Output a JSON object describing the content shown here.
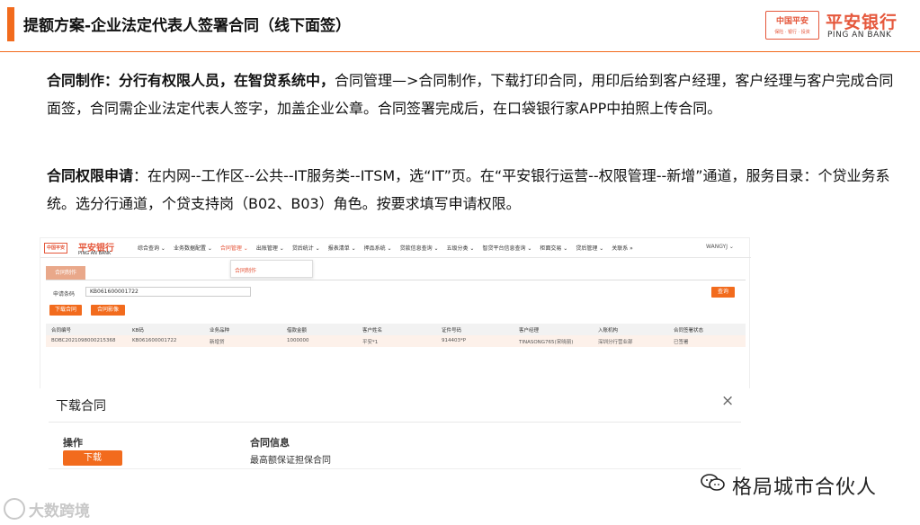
{
  "slide": {
    "title": "提额方案-企业法定代表人签署合同（线下面签）",
    "brand_box_cn": "中国平安",
    "brand_box_sub": "保险 · 银行 · 投资",
    "bank_name_cn": "平安银行",
    "bank_name_en": "PING AN BANK"
  },
  "para1": {
    "bold_part": "合同制作：分行有权限人员，在智贷系统中，",
    "text": "合同管理—>合同制作，下载打印合同，用印后给到客户经理，客户经理与客户完成合同面签，合同需企业法定代表人签字，加盖企业公章。合同签署完成后，在口袋银行家APP中拍照上传合同。"
  },
  "para2": {
    "bold_part": "合同权限申请",
    "text": "：在内网--工作区--公共--IT服务类--ITSM，选“IT”页。在“平安银行运营--权限管理--新增”通道，服务目录：个贷业务系统。选分行通道，个贷支持岗（B02、B03）角色。按要求填写申请权限。"
  },
  "system": {
    "logo_box": "中国平安",
    "logo_cn": "平安银行",
    "logo_en": "PING AN BANK",
    "menu": [
      "综合查询 ⌄",
      "业务数据配置 ⌄",
      "合同管理 ⌄",
      "出账管理 ⌄",
      "贷后统计 ⌄",
      "报表清单 ⌄",
      "押品系统 ⌄",
      "贷款信息查询 ⌄",
      "五级分类 ⌄",
      "智贷平台信息查询 ⌄",
      "柜面交易 ⌄",
      "贷后管理 ⌄",
      "关联系 »"
    ],
    "active_menu_index": 2,
    "user": "WANGYJ ⌄",
    "dropdown_item": "合同制作",
    "tab": "合同制作",
    "search_label": "申请条码",
    "search_value": "KB061600001722",
    "query_button": "查询",
    "download_button": "下载合同",
    "print_button": "合同影像",
    "table_headers": [
      "合同编号",
      "KB码",
      "业务品种",
      "借款金额",
      "客户姓名",
      "证件号码",
      "客户经理",
      "入账机构",
      "合同签署状态"
    ],
    "table_row": [
      "BOBC2021098000215368",
      "KB061600001722",
      "新增贷",
      "1000000",
      "平安*1",
      "914403*P",
      "TINASONG765(宋晓丽)",
      "深圳分行营业部",
      "已签署"
    ]
  },
  "dialog": {
    "title": "下载合同",
    "close_icon": "×",
    "col_action": "操作",
    "col_info": "合同信息",
    "download_button": "下载",
    "contract_name": "最高额保证担保合同"
  },
  "watermarks": {
    "source": "大数跨境",
    "wechat_account": "格局城市合伙人"
  },
  "colors": {
    "accent": "#f26b1d",
    "brand_red": "#e5573b"
  }
}
